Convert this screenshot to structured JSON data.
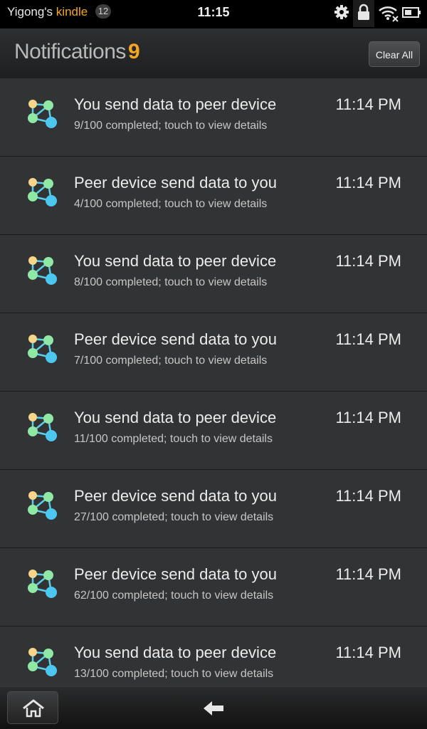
{
  "status_bar": {
    "owner": "Yigong's",
    "brand": "kindle",
    "badge_count": "12",
    "time": "11:15",
    "icons": [
      "gear-icon",
      "lock-icon",
      "wifi-icon",
      "battery-icon"
    ]
  },
  "header": {
    "title": "Notifications",
    "count": "9",
    "clear_all_label": "Clear All"
  },
  "notifications": [
    {
      "title": "You send data to peer device",
      "detail": "9/100 completed; touch to view details",
      "time": "11:14 PM",
      "progress": 9
    },
    {
      "title": "Peer device send data to you",
      "detail": "4/100 completed; touch to view details",
      "time": "11:14 PM",
      "progress": 4
    },
    {
      "title": "You send data to peer device",
      "detail": "8/100 completed; touch to view details",
      "time": "11:14 PM",
      "progress": 8
    },
    {
      "title": "Peer device send data to you",
      "detail": "7/100 completed; touch to view details",
      "time": "11:14 PM",
      "progress": 7
    },
    {
      "title": "You send data to peer device",
      "detail": "11/100 completed; touch to view details",
      "time": "11:14 PM",
      "progress": 11
    },
    {
      "title": "Peer device send data to you",
      "detail": "27/100 completed; touch to view details",
      "time": "11:14 PM",
      "progress": 27
    },
    {
      "title": "Peer device send data to you",
      "detail": "62/100 completed; touch to view details",
      "time": "11:14 PM",
      "progress": 62
    },
    {
      "title": "You send data to peer device",
      "detail": "13/100 completed; touch to view details",
      "time": "11:14 PM",
      "progress": 13
    }
  ],
  "nav": {
    "icons": [
      "home-icon",
      "back-arrow-icon"
    ]
  },
  "colors": {
    "accent": "#f5a623",
    "background": "#323334",
    "node_yellow": "#f7d58a",
    "node_green": "#8fe8a4",
    "node_blue": "#4cc8f0"
  }
}
